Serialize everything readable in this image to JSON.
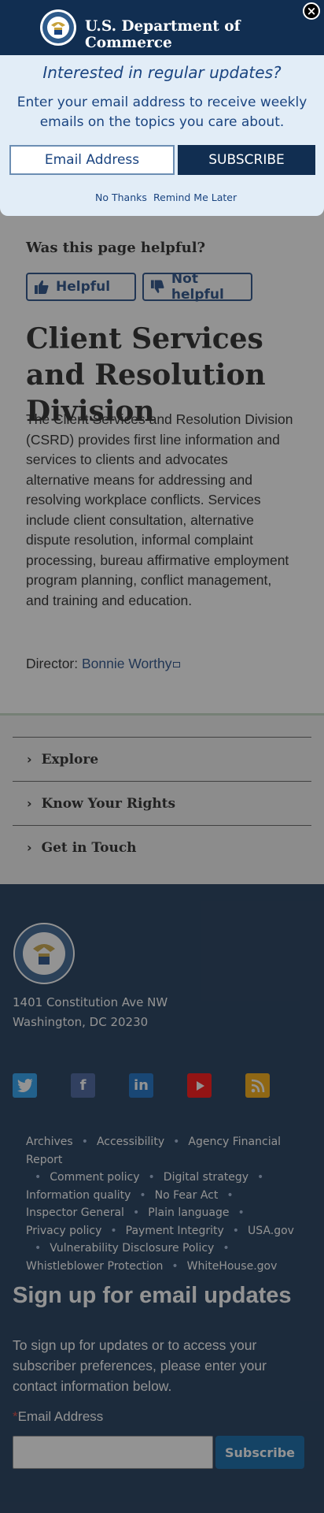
{
  "agency": {
    "name": "U.S. Department of Commerce"
  },
  "popup": {
    "heading": "Interested in regular updates?",
    "text": "Enter your email address to receive weekly emails on the topics you care about.",
    "email_placeholder": "Email Address",
    "subscribe_label": "SUBSCRIBE",
    "no_thanks": "No Thanks",
    "remind_later": "Remind Me Later",
    "close_label": "×"
  },
  "feedback": {
    "question": "Was this page helpful?",
    "helpful": "Helpful",
    "not_helpful": "Not helpful"
  },
  "main": {
    "title": "Client Services and Resolution Division",
    "body": "The Client Services and Resolution Division (CSRD) provides first line information and services to clients and advocates alternative means for addressing and resolving workplace conflicts.  Services include client consultation, alternative dispute resolution, informal complaint processing, bureau affirmative employment program planning, conflict management, and training and education.",
    "director_label": "Director: ",
    "director_name": "Bonnie Worthy"
  },
  "accordion": [
    {
      "label": "Explore"
    },
    {
      "label": "Know Your Rights"
    },
    {
      "label": "Get in Touch"
    }
  ],
  "footer": {
    "address_line1": "1401 Constitution Ave NW",
    "address_line2": "Washington, DC 20230",
    "social": [
      {
        "name": "twitter-icon",
        "color": "#1d9bf0"
      },
      {
        "name": "facebook-icon",
        "color": "#3b5998"
      },
      {
        "name": "linkedin-icon",
        "color": "#0a66c2"
      },
      {
        "name": "youtube-icon",
        "color": "#ff0000"
      },
      {
        "name": "rss-icon",
        "color": "#f7a600"
      }
    ],
    "links": [
      "Archives",
      "Accessibility",
      "Agency Financial Report",
      "Comment policy",
      "Digital strategy",
      "Information quality",
      "No Fear Act",
      "Inspector General",
      "Plain language",
      "Privacy policy",
      "Payment Integrity",
      "USA.gov",
      "Vulnerability Disclosure Policy",
      "Whistleblower Protection",
      "WhiteHouse.gov"
    ],
    "signup_title": "Sign up for email updates",
    "signup_text": "To sign up for updates or to access your subscriber preferences, please enter your contact information below.",
    "email_required_mark": "*",
    "email_label": "Email Address",
    "subscribe_label": "Subscribe"
  },
  "colors": {
    "navy": "#112e51",
    "accent_blue": "#1a4480",
    "popup_bg": "#e2edf7",
    "footer_button": "#005ea2"
  }
}
